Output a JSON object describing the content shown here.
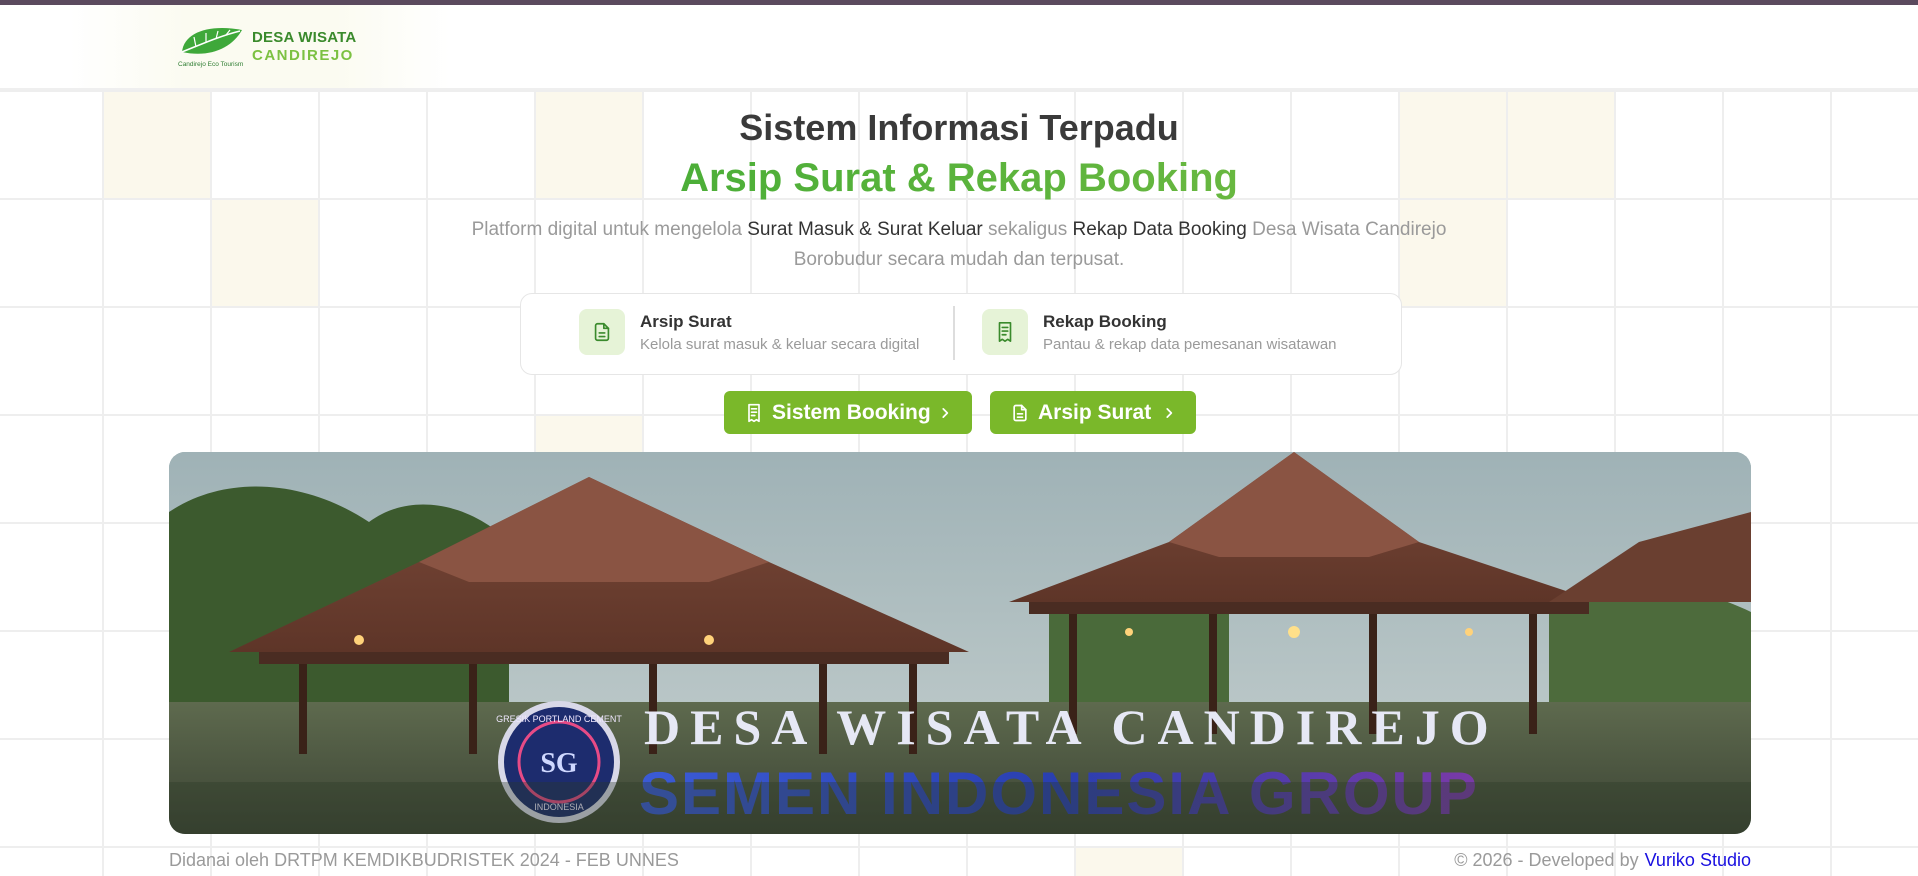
{
  "logo": {
    "line1": "DESA WISATA",
    "line2": "CANDIREJO",
    "tagline": "Candirejo Eco Tourism"
  },
  "hero": {
    "title_line1": "Sistem Informasi Terpadu",
    "title_line2": "Arsip Surat & Rekap Booking",
    "desc_part1": "Platform digital untuk mengelola ",
    "desc_bold1": "Surat Masuk & Surat Keluar",
    "desc_part2": " sekaligus ",
    "desc_bold2": "Rekap Data Booking",
    "desc_part3": " Desa Wisata Candirejo Borobudur secara mudah dan terpusat."
  },
  "features": [
    {
      "icon": "document-icon",
      "title": "Arsip Surat",
      "subtitle": "Kelola surat masuk & keluar secara digital"
    },
    {
      "icon": "receipt-icon",
      "title": "Rekap Booking",
      "subtitle": "Pantau & rekap data pemesanan wisatawan"
    }
  ],
  "buttons": {
    "booking": {
      "label": "Sistem Booking",
      "icon": "receipt-icon"
    },
    "arsip": {
      "label": "Arsip Surat",
      "icon": "document-icon"
    }
  },
  "banner": {
    "sign_text": "DESA WISATA CANDIREJO",
    "sponsor_text": "SEMEN INDONESIA GROUP",
    "seal_text": "GRESIK PORTLAND CEMENT",
    "seal_sub": "INDONESIA"
  },
  "footer": {
    "funding": "Didanai oleh DRTPM KEMDIKBUDRISTEK 2024 - FEB UNNES",
    "copyright": "© 2026 - Developed by",
    "developer": "Vuriko Studio"
  },
  "colors": {
    "brand_green": "#7ab82a",
    "title_green_start": "#29a32e",
    "title_green_end": "#8bc34a",
    "top_bar": "#5b4a5e",
    "link_blue": "#1a10e0"
  }
}
